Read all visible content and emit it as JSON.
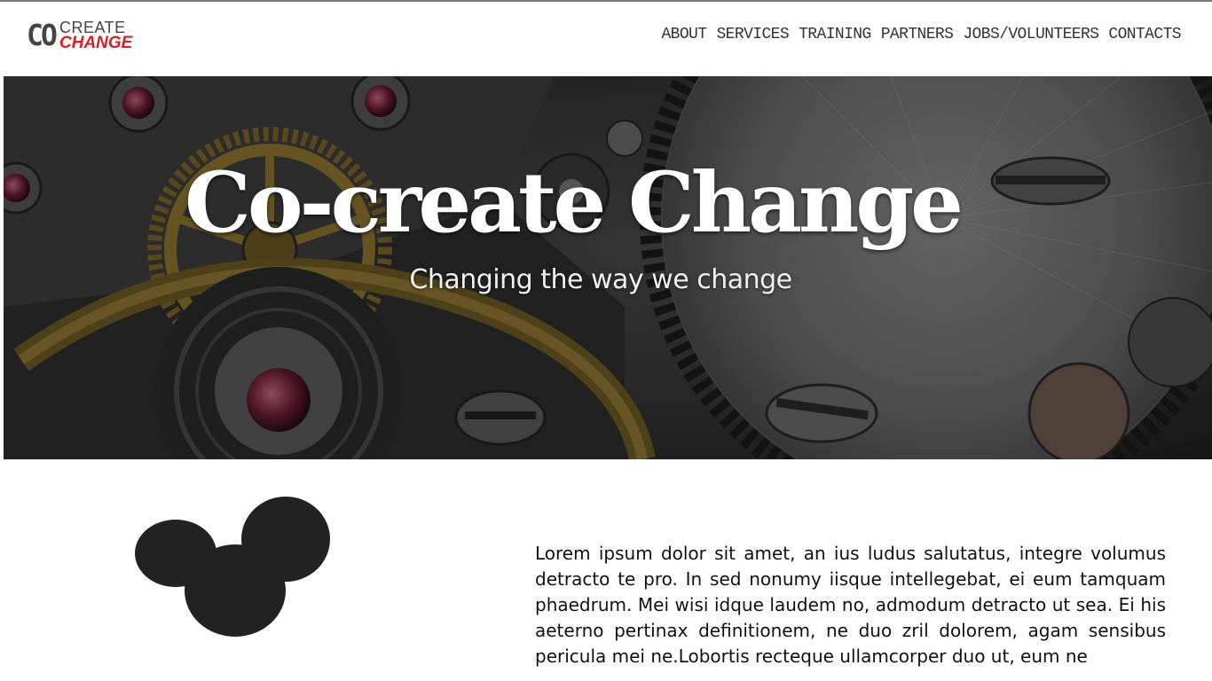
{
  "logo": {
    "co": "CO",
    "create": "CREATE",
    "change": "CHANGE",
    "colors": {
      "primary": "#444444",
      "accent": "#d62027"
    }
  },
  "nav": {
    "items": [
      {
        "label": "ABOUT"
      },
      {
        "label": "SERVICES"
      },
      {
        "label": "TRAINING"
      },
      {
        "label": "PARTNERS"
      },
      {
        "label": "JOBS/VOLUNTEERS"
      },
      {
        "label": "CONTACTS"
      }
    ]
  },
  "hero": {
    "title": "Co-create Change",
    "subtitle": "Changing the way we change",
    "background": "gears-image"
  },
  "content": {
    "illustration": "three-circles-graphic",
    "paragraph": "Lorem ipsum dolor sit amet, an ius ludus salutatus, integre volumus detracto te pro. In sed nonumy iisque intellegebat, ei eum tamquam phaedrum. Mei wisi idque laudem no, admodum detracto ut sea. Ei his aeterno pertinax definitionem, ne duo zril dolorem, agam sensibus pericula mei ne.Lobortis recteque ullamcorper duo ut, eum ne"
  },
  "colors": {
    "circle_fill": "#222222",
    "text": "#111111",
    "nav_text": "#333333"
  }
}
